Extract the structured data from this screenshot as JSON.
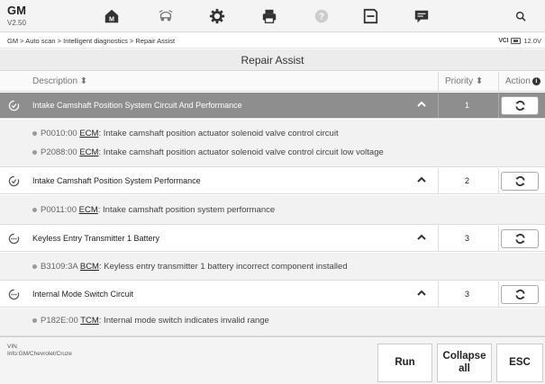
{
  "app": {
    "name": "GM",
    "version": "V2.50"
  },
  "toolbar": {
    "items": [
      {
        "icon": "home-icon"
      },
      {
        "icon": "vehicle-swap-icon"
      },
      {
        "icon": "settings-icon"
      },
      {
        "icon": "print-icon"
      },
      {
        "icon": "help-icon"
      },
      {
        "icon": "save-icon"
      },
      {
        "icon": "message-icon"
      },
      {
        "icon": "search-icon"
      }
    ]
  },
  "breadcrumb": "GM > Auto scan > Intelligent diagnostics > Repair Assist",
  "status": {
    "vci_label": "VCI",
    "voltage": "12.0V"
  },
  "page": {
    "title": "Repair Assist"
  },
  "table": {
    "headers": {
      "description": "Description ⬍",
      "priority": "Priority ⬍",
      "action": "Action"
    },
    "rows": [
      {
        "label": "Intake Camshaft Position System Circuit And Performance",
        "priority": "1",
        "active": true,
        "dtcs": [
          {
            "code": "P0010:00",
            "module": "ECM",
            "text": ": Intake camshaft position actuator solenoid valve control circuit"
          },
          {
            "code": "P2088:00",
            "module": "ECM",
            "text": ": Intake camshaft position actuator solenoid valve control circuit low voltage"
          }
        ]
      },
      {
        "label": "Intake Camshaft Position System Performance",
        "priority": "2",
        "active": false,
        "dtcs": [
          {
            "code": "P0011:00",
            "module": "ECM",
            "text": ": Intake camshaft position system performance"
          }
        ]
      },
      {
        "label": "Keyless Entry Transmitter 1 Battery",
        "priority": "3",
        "active": false,
        "dtcs": [
          {
            "code": "B3109:3A",
            "module": "BCM",
            "text": ": Keyless entry transmitter 1 battery incorrect component installed"
          }
        ]
      },
      {
        "label": "Internal Mode Switch Circuit",
        "priority": "3",
        "active": false,
        "dtcs": [
          {
            "code": "P182E:00",
            "module": "TCM",
            "text": ": Internal mode switch indicates invalid range"
          }
        ]
      }
    ]
  },
  "vehicle": {
    "vin_label": "VIN",
    "info": "Info:GM/Chevrolet/Cruze"
  },
  "buttons": {
    "run": "Run",
    "collapse_line1": "Collapse",
    "collapse_line2": "all",
    "esc": "ESC"
  },
  "colors": {
    "active_row": "#8e8e8e",
    "sub_row": "#f2f2f2"
  }
}
